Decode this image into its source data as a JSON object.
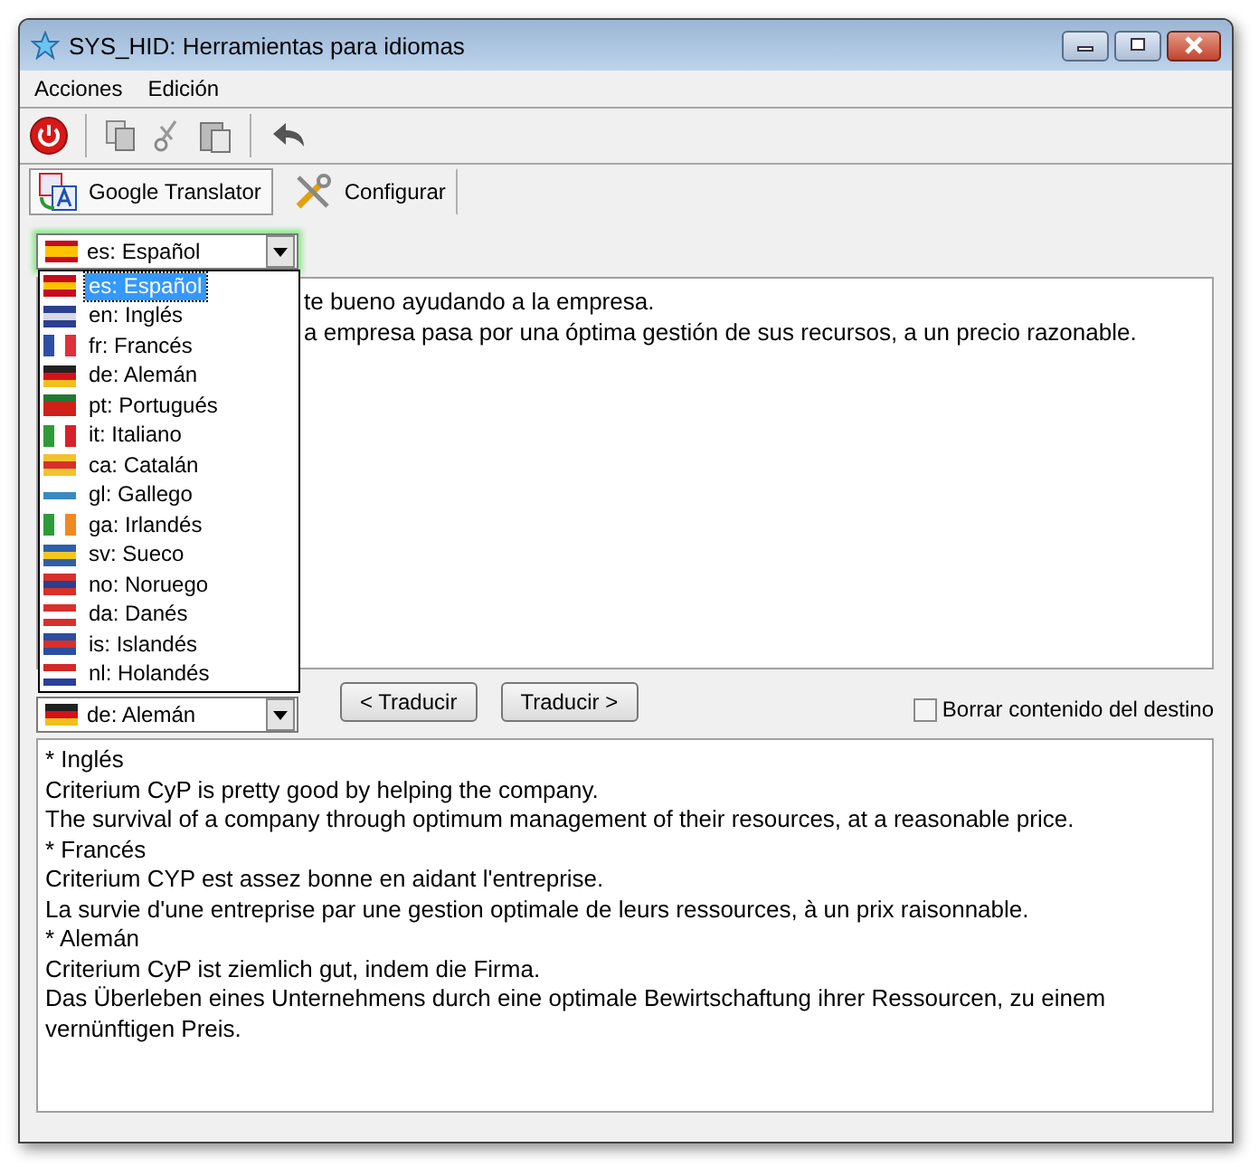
{
  "window": {
    "title": "SYS_HID: Herramientas para idiomas"
  },
  "menu": [
    "Acciones",
    "Edición"
  ],
  "tabs": [
    {
      "label": "Google Translator",
      "selected": true
    },
    {
      "label": "Configurar",
      "selected": false
    }
  ],
  "source_language": {
    "value": "es: Español"
  },
  "language_list": [
    {
      "label": "es: Español",
      "selected": true
    },
    {
      "label": "en: Inglés",
      "selected": false
    },
    {
      "label": "fr: Francés",
      "selected": false
    },
    {
      "label": "de: Alemán",
      "selected": false
    },
    {
      "label": "pt: Portugués",
      "selected": false
    },
    {
      "label": "it: Italiano",
      "selected": false
    },
    {
      "label": "ca: Catalán",
      "selected": false
    },
    {
      "label": "gl: Gallego",
      "selected": false
    },
    {
      "label": "ga: Irlandés",
      "selected": false
    },
    {
      "label": "sv: Sueco",
      "selected": false
    },
    {
      "label": "no: Noruego",
      "selected": false
    },
    {
      "label": "da: Danés",
      "selected": false
    },
    {
      "label": "is: Islandés",
      "selected": false
    },
    {
      "label": "nl: Holandés",
      "selected": false
    }
  ],
  "source_text": [
    "te bueno ayudando a la empresa.",
    "a empresa pasa por una óptima gestión de sus recursos, a un precio razonable."
  ],
  "target_language": {
    "value": "de: Alemán"
  },
  "buttons": [
    "< Traducir",
    "Traducir >"
  ],
  "clear_target": {
    "label": "Borrar contenido del destino",
    "checked": false
  },
  "target_text": [
    "* Inglés",
    "Criterium CyP is pretty good by helping the company.",
    "The survival of a company through optimum management of their resources, at a reasonable price.",
    "* Francés",
    "Criterium CYP est assez bonne en aidant l'entreprise.",
    "La survie d'une entreprise par une gestion optimale de leurs ressources, à un prix raisonnable.",
    "* Alemán",
    "Criterium CyP ist ziemlich gut, indem die Firma.",
    "Das Überleben eines Unternehmens durch eine optimale Bewirtschaftung ihrer Ressourcen, zu einem",
    "vernünftigen Preis."
  ]
}
